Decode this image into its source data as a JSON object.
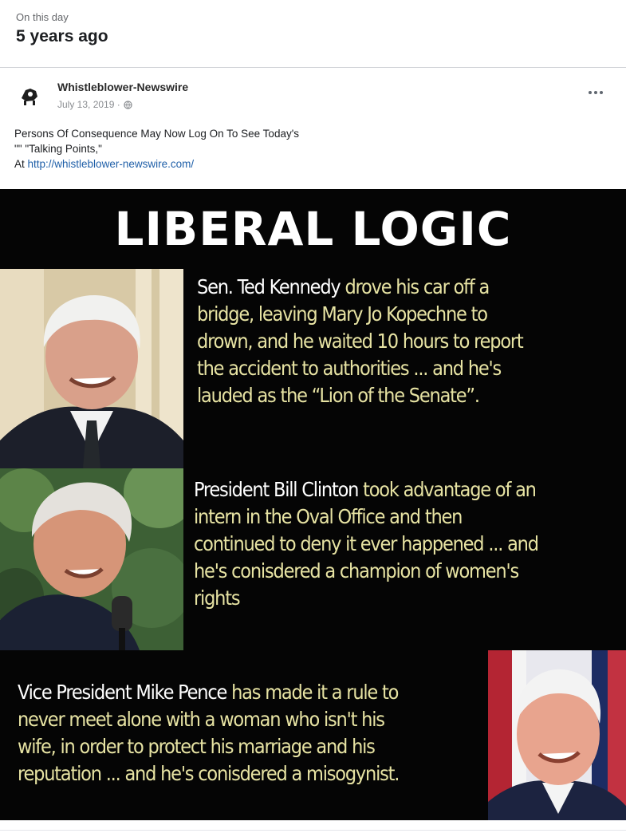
{
  "memory": {
    "label": "On this day",
    "title": "5 years ago"
  },
  "post": {
    "author": "Whistleblower-Newswire",
    "date": "July 13, 2019 ·",
    "privacy_icon": "globe-icon",
    "text_line1": "Persons Of Consequence May Now Log On To See Today's",
    "text_line2": "\"\" \"Talking Points,\"",
    "text_line3_prefix": "At ",
    "link": "http://whistleblower-newswire.com/",
    "more_icon": "more-options-icon"
  },
  "meme": {
    "title": "LIBERAL LOGIC",
    "blocks": [
      {
        "name": "Sen. Ted Kennedy",
        "text_first": " drove his car off a",
        "lines": [
          "bridge, leaving Mary Jo Kopechne to",
          "drown, and he waited 10 hours to report",
          "the accident to authorities ... and he's",
          "lauded as the “Lion of the Senate”."
        ]
      },
      {
        "name": "President Bill Clinton",
        "text_first": " took advantage of an",
        "lines": [
          "intern in the Oval Office and then",
          "continued to deny it ever happened ... and",
          "he's conisdered a champion of women's",
          "rights"
        ]
      },
      {
        "name": "Vice President Mike Pence",
        "text_first": " has made it a rule to",
        "lines": [
          "never meet alone with a woman who isn't his",
          "wife, in order to protect his marriage and his",
          "reputation ... and he's conisdered a misogynist."
        ]
      }
    ]
  },
  "colors": {
    "meme_background": "#050505",
    "meme_text": "#e7e3a3",
    "link": "#1f5fa8"
  }
}
